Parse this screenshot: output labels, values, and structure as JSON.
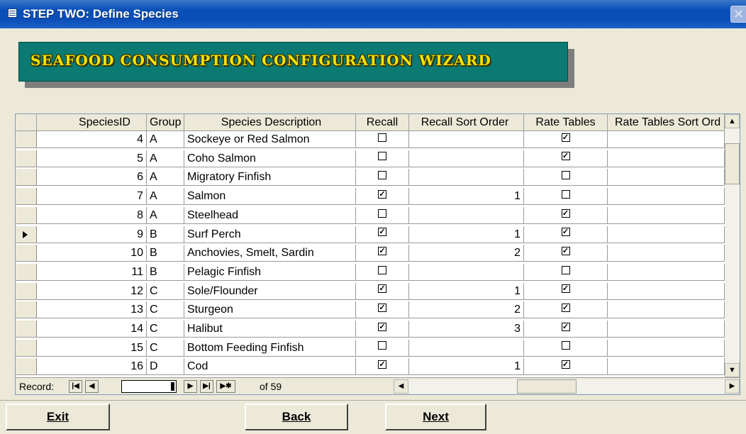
{
  "window": {
    "title": "STEP TWO:  Define Species",
    "close_label": "✕"
  },
  "banner": {
    "text": "SEAFOOD CONSUMPTION CONFIGURATION WIZARD"
  },
  "table": {
    "columns": [
      "SpeciesID",
      "Group ID",
      "Species Description",
      "Recall",
      "Recall Sort Order",
      "Rate Tables",
      "Rate Tables Sort Ord"
    ],
    "rows": [
      {
        "id": "4",
        "group": "A",
        "desc": "Sockeye or Red Salmon",
        "recall": false,
        "recall_sort": "",
        "rate_tables": true
      },
      {
        "id": "5",
        "group": "A",
        "desc": "Coho Salmon",
        "recall": false,
        "recall_sort": "",
        "rate_tables": true
      },
      {
        "id": "6",
        "group": "A",
        "desc": "Migratory Finfish",
        "recall": false,
        "recall_sort": "",
        "rate_tables": false
      },
      {
        "id": "7",
        "group": "A",
        "desc": "Salmon",
        "recall": true,
        "recall_sort": "1",
        "rate_tables": false
      },
      {
        "id": "8",
        "group": "A",
        "desc": "Steelhead",
        "recall": false,
        "recall_sort": "",
        "rate_tables": true
      },
      {
        "id": "9",
        "group": "B",
        "desc": "Surf Perch",
        "recall": true,
        "recall_sort": "1",
        "rate_tables": true,
        "current": true
      },
      {
        "id": "10",
        "group": "B",
        "desc": "Anchovies, Smelt, Sardin",
        "recall": true,
        "recall_sort": "2",
        "rate_tables": true
      },
      {
        "id": "11",
        "group": "B",
        "desc": "Pelagic Finfish",
        "recall": false,
        "recall_sort": "",
        "rate_tables": false
      },
      {
        "id": "12",
        "group": "C",
        "desc": "Sole/Flounder",
        "recall": true,
        "recall_sort": "1",
        "rate_tables": true
      },
      {
        "id": "13",
        "group": "C",
        "desc": "Sturgeon",
        "recall": true,
        "recall_sort": "2",
        "rate_tables": true
      },
      {
        "id": "14",
        "group": "C",
        "desc": "Halibut",
        "recall": true,
        "recall_sort": "3",
        "rate_tables": true
      },
      {
        "id": "15",
        "group": "C",
        "desc": "Bottom Feeding Finfish",
        "recall": false,
        "recall_sort": "",
        "rate_tables": false
      },
      {
        "id": "16",
        "group": "D",
        "desc": "Cod",
        "recall": true,
        "recall_sort": "1",
        "rate_tables": true
      }
    ]
  },
  "navigator": {
    "label": "Record:",
    "current": "",
    "of_text": "of 59"
  },
  "buttons": {
    "exit": "Exit",
    "back": "Back",
    "next": "Next"
  },
  "colors": {
    "titlebar": "#0a4fb8",
    "banner_bg": "#0a7a73",
    "banner_text": "#f0e400",
    "window_bg": "#ece9d8"
  }
}
